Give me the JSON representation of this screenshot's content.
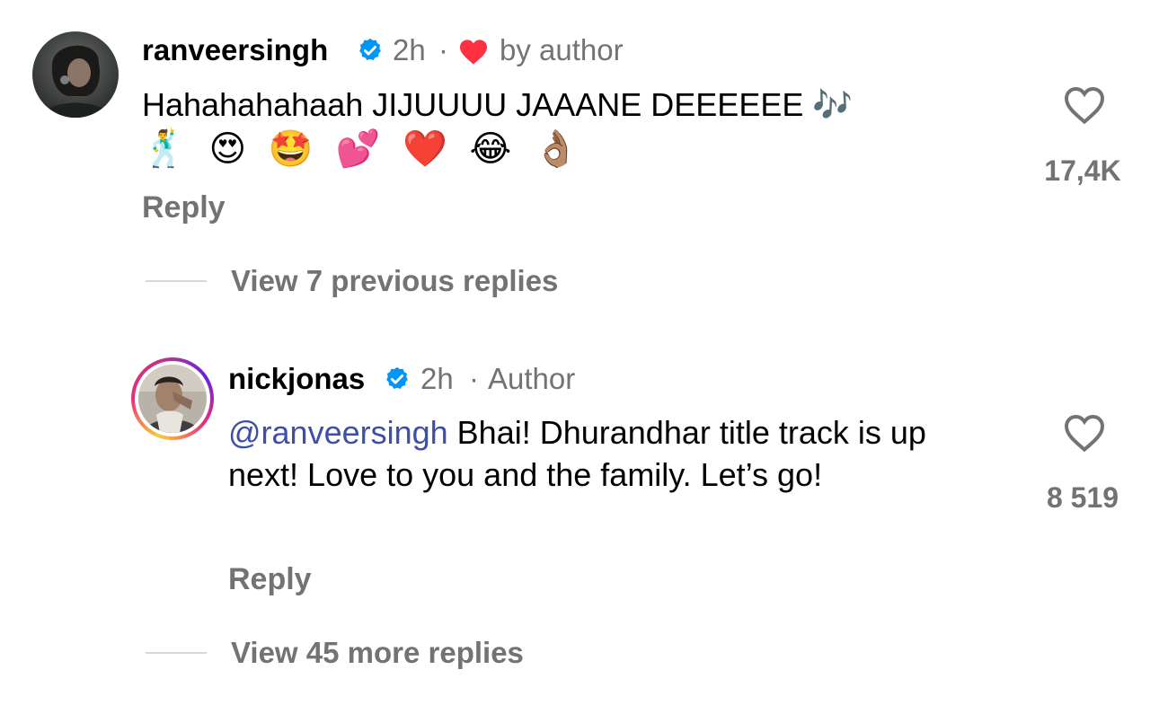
{
  "comments": [
    {
      "username": "ranveersingh",
      "time": "2h",
      "separator": "·",
      "badge": "by author",
      "text": "Hahahahahaah JIJUUUU JAAANE DEEEEEE 🎶",
      "emojis": "🕺 😍 🤩 💕 ❤️ 😂 👌🏽",
      "likes": "17,4K",
      "reply_label": "Reply",
      "thread_link": "View 7 previous replies"
    },
    {
      "username": "nickjonas",
      "time": "2h",
      "separator": "·",
      "badge": "Author",
      "mention": "@ranveersingh",
      "text": " Bhai! Dhurandhar title track is up next! Love to you and the family. Let’s go!",
      "likes": "8 519",
      "reply_label": "Reply",
      "thread_link": "View 45 more replies"
    }
  ],
  "colors": {
    "muted": "#737373",
    "mention": "#3d4fa8",
    "verified": "#0095f6",
    "liked_heart": "#ff3040"
  },
  "icons": [
    "verified-badge-icon",
    "heart-filled-icon",
    "heart-outline-icon"
  ]
}
